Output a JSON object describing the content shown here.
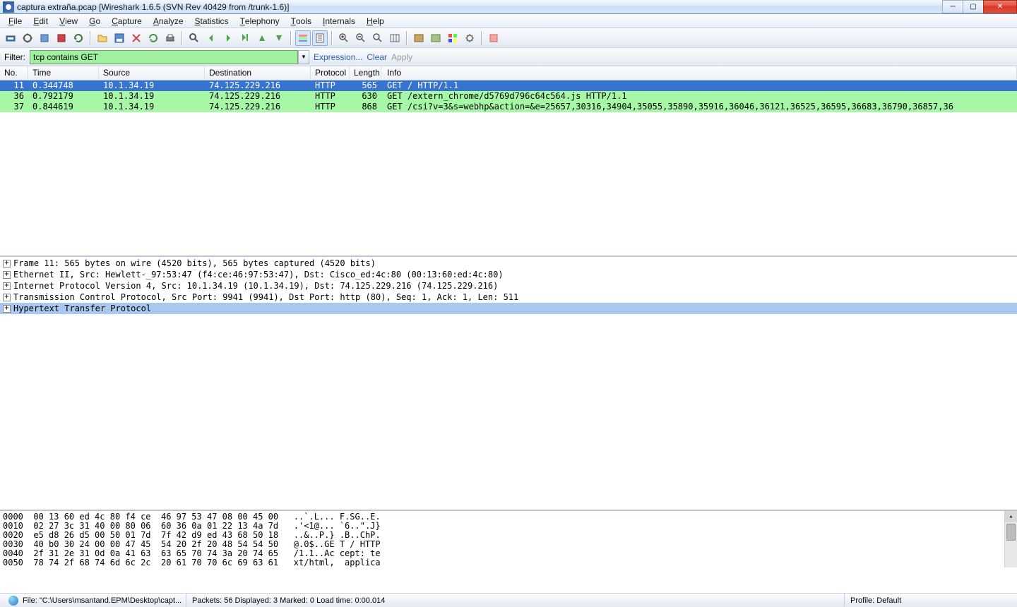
{
  "title": "captura extraña.pcap   [Wireshark 1.6.5  (SVN Rev 40429 from /trunk-1.6)]",
  "menu": {
    "items": [
      "File",
      "Edit",
      "View",
      "Go",
      "Capture",
      "Analyze",
      "Statistics",
      "Telephony",
      "Tools",
      "Internals",
      "Help"
    ]
  },
  "filter": {
    "label": "Filter:",
    "value": "tcp contains GET",
    "expr": "Expression...",
    "clear": "Clear",
    "apply": "Apply"
  },
  "packets": {
    "headers": [
      "No.",
      "Time",
      "Source",
      "Destination",
      "Protocol",
      "Length",
      "Info"
    ],
    "rows": [
      {
        "no": "11",
        "time": "0.344748",
        "src": "10.1.34.19",
        "dst": "74.125.229.216",
        "proto": "HTTP",
        "len": "565",
        "info": "GET / HTTP/1.1",
        "sel": true,
        "green": false
      },
      {
        "no": "36",
        "time": "0.792179",
        "src": "10.1.34.19",
        "dst": "74.125.229.216",
        "proto": "HTTP",
        "len": "630",
        "info": "GET /extern_chrome/d5769d796c64c564.js HTTP/1.1",
        "sel": false,
        "green": true
      },
      {
        "no": "37",
        "time": "0.844619",
        "src": "10.1.34.19",
        "dst": "74.125.229.216",
        "proto": "HTTP",
        "len": "868",
        "info": "GET /csi?v=3&s=webhp&action=&e=25657,30316,34904,35055,35890,35916,36046,36121,36525,36595,36683,36790,36857,36",
        "sel": false,
        "green": true
      }
    ]
  },
  "details": [
    {
      "text": "Frame 11: 565 bytes on wire (4520 bits), 565 bytes captured (4520 bits)",
      "sel": false
    },
    {
      "text": "Ethernet II, Src: Hewlett-_97:53:47 (f4:ce:46:97:53:47), Dst: Cisco_ed:4c:80 (00:13:60:ed:4c:80)",
      "sel": false
    },
    {
      "text": "Internet Protocol Version 4, Src: 10.1.34.19 (10.1.34.19), Dst: 74.125.229.216 (74.125.229.216)",
      "sel": false
    },
    {
      "text": "Transmission Control Protocol, Src Port: 9941 (9941), Dst Port: http (80), Seq: 1, Ack: 1, Len: 511",
      "sel": false
    },
    {
      "text": "Hypertext Transfer Protocol",
      "sel": true
    }
  ],
  "hex": [
    "0000  00 13 60 ed 4c 80 f4 ce  46 97 53 47 08 00 45 00   ..`.L... F.SG..E.",
    "0010  02 27 3c 31 40 00 80 06  60 36 0a 01 22 13 4a 7d   .'<1@... `6..\".J}",
    "0020  e5 d8 26 d5 00 50 01 7d  7f 42 d9 ed 43 68 50 18   ..&..P.} .B..ChP.",
    "0030  40 b0 30 24 00 00 47 45  54 20 2f 20 48 54 54 50   @.0$..GE T / HTTP",
    "0040  2f 31 2e 31 0d 0a 41 63  63 65 70 74 3a 20 74 65   /1.1..Ac cept: te",
    "0050  78 74 2f 68 74 6d 6c 2c  20 61 70 70 6c 69 63 61   xt/html,  applica"
  ],
  "status": {
    "file": "File: \"C:\\Users\\msantand.EPM\\Desktop\\capt...",
    "packets": "Packets: 56 Displayed: 3 Marked: 0 Load time: 0:00.014",
    "profile": "Profile: Default"
  },
  "colors": {
    "select": "#3774d0",
    "green_row": "#a6f7a6",
    "detail_sel": "#a8c8f0"
  }
}
